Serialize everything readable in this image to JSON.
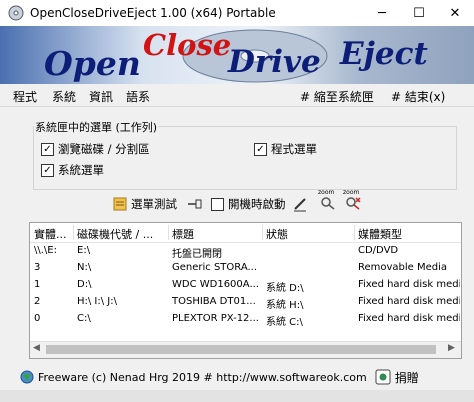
{
  "window": {
    "title": "OpenCloseDriveEject 1.00 (x64) Portable",
    "minimize_glyph": "─",
    "maximize_glyph": "☐",
    "close_glyph": "✕"
  },
  "banner": {
    "open": "Open",
    "close": "Close",
    "drive": "Drive",
    "eject": "Eject"
  },
  "menu": {
    "program": "程式",
    "system": "系統",
    "info": "資訊",
    "language": "語系",
    "minimize_tray": "# 縮至系統匣",
    "exit": "# 結束(x)"
  },
  "options": {
    "group_label": "系統匣中的選單 (工作列)",
    "browse_disk": "瀏覽磁碟 / 分割區",
    "program_menu": "程式選單",
    "system_menu": "系統選單",
    "browse_disk_checked": true,
    "program_menu_checked": true,
    "system_menu_checked": true
  },
  "toolbar": {
    "menu_test": "選單測試",
    "autostart": "開機時啟動",
    "autostart_checked": false,
    "zoom_in": "zoom",
    "zoom_out": "zoom"
  },
  "drives": {
    "columns": [
      "實體...",
      "磁碟機代號 / ...",
      "標題",
      "狀態",
      "媒體類型"
    ],
    "rows": [
      [
        "\\\\.\\E:",
        "E:\\",
        "托盤已開閉",
        "",
        "CD/DVD"
      ],
      [
        "3",
        "N:\\",
        "Generic STORA...",
        "",
        "Removable Media"
      ],
      [
        "1",
        "D:\\",
        "WDC WD1600A...",
        "系統 D:\\",
        "Fixed hard disk medi"
      ],
      [
        "2",
        "H:\\ I:\\ J:\\",
        "TOSHIBA DT01...",
        "系統 H:\\",
        "Fixed hard disk medi"
      ],
      [
        "0",
        "C:\\",
        "PLEXTOR PX-12...",
        "系統 C:\\",
        "Fixed hard disk medi"
      ]
    ]
  },
  "footer": {
    "text": "Freeware (c) Nenad Hrg 2019 # http://www.softwareok.com",
    "donate": "捐贈"
  },
  "colors": {
    "banner_red": "#d11313",
    "banner_blue": "#0d1e78",
    "accent": "#0078d7"
  }
}
